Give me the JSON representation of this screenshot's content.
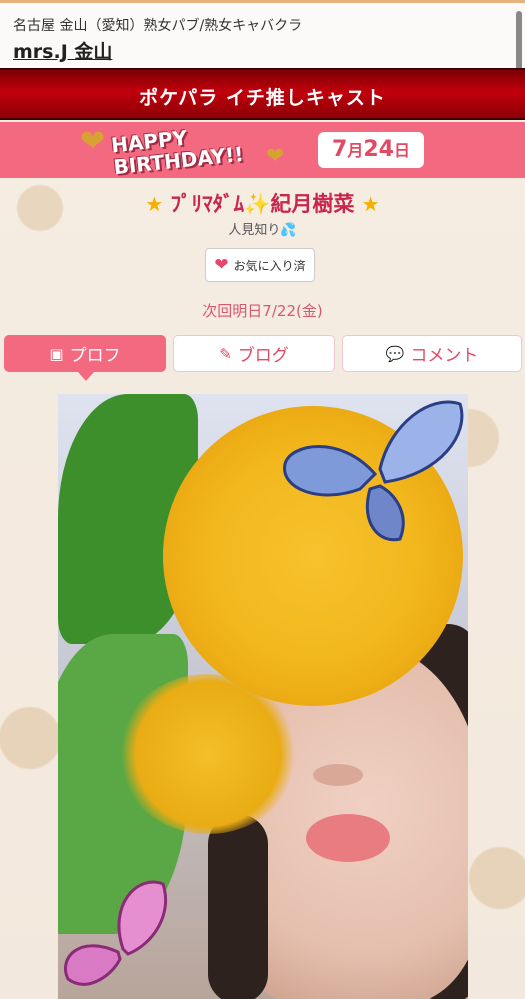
{
  "header": {
    "area": "名古屋 金山（愛知）熟女パブ/熟女キャバクラ",
    "shop_name": "mrs.J 金山"
  },
  "banner": {
    "title": "ポケパラ イチ推しキャスト"
  },
  "birthday": {
    "line1": "HAPPY",
    "line2": "BIRTHDAY!!",
    "month": "7",
    "month_unit": "月",
    "day": "24",
    "day_unit": "日"
  },
  "cast": {
    "name": "ﾌﾟﾘﾏﾀﾞﾑ✨紀月樹菜",
    "tagline": "人見知り💦"
  },
  "favorite": {
    "label": "お気に入り済"
  },
  "next_shift": "次回明日7/22(金)",
  "tabs": [
    {
      "label": "プロフ"
    },
    {
      "label": "ブログ"
    },
    {
      "label": "コメント"
    }
  ],
  "colors": {
    "accent": "#f36a80",
    "banner": "#c1000c",
    "text_accent": "#e24a63"
  },
  "icons": {
    "profile": "id-card-icon",
    "blog": "edit-icon",
    "comment": "chat-bubble-icon",
    "favorite": "heart-icon"
  }
}
